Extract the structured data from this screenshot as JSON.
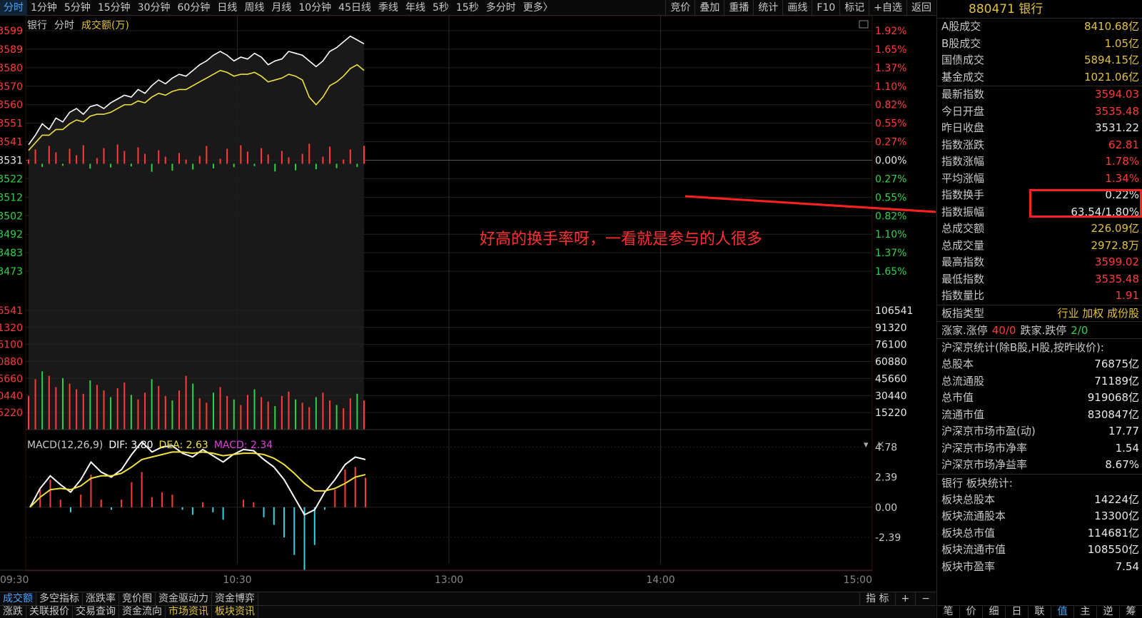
{
  "toolbar": {
    "periods": [
      "分时",
      "1分钟",
      "5分钟",
      "15分钟",
      "30分钟",
      "60分钟",
      "日线",
      "周线",
      "月线",
      "10分钟",
      "45日线",
      "季线",
      "年线",
      "5秒",
      "15秒",
      "多分时",
      "更多〉"
    ],
    "active_period": "分时",
    "tools": [
      "竞价",
      "叠加",
      "重播",
      "统计",
      "画线",
      "F10",
      "标记",
      "+自选",
      "返回"
    ]
  },
  "chart_header": {
    "name": "银行",
    "mode": "分时",
    "amount": "成交额(万)"
  },
  "macd_header": {
    "label": "MACD(12,26,9)",
    "dif": "DIF: 3.80",
    "dea": "DEA: 2.63",
    "macd": "MACD: 2.34"
  },
  "macd_controls": {
    "collapse": "▾",
    "close": "×"
  },
  "annotation": "好高的换手率呀，一看就是参与的人很多",
  "indicator_tabs": [
    "成交额",
    "多空指标",
    "涨跌率",
    "竞价图",
    "资金驱动力",
    "资金博弈"
  ],
  "indicator_controls": [
    "指 标",
    "+",
    "−"
  ],
  "info_tabs": [
    "涨跌",
    "关联报价",
    "交易查询",
    "资金流向",
    "市场资讯",
    "板块资讯"
  ],
  "info_tabs_highlight": [
    "市场资讯",
    "板块资讯"
  ],
  "panel": {
    "title": "880471 银行",
    "group1": [
      {
        "k": "A股成交",
        "v": "8410.68亿",
        "c": "yel"
      },
      {
        "k": "B股成交",
        "v": "1.05亿",
        "c": "yel"
      },
      {
        "k": "国债成交",
        "v": "5894.15亿",
        "c": "yel"
      },
      {
        "k": "基金成交",
        "v": "1021.06亿",
        "c": "yel"
      }
    ],
    "group2": [
      {
        "k": "最新指数",
        "v": "3594.03",
        "c": "red"
      },
      {
        "k": "今日开盘",
        "v": "3535.48",
        "c": "red"
      },
      {
        "k": "昨日收盘",
        "v": "3531.22",
        "c": "wht"
      },
      {
        "k": "指数涨跌",
        "v": "62.81",
        "c": "red"
      },
      {
        "k": "指数涨幅",
        "v": "1.78%",
        "c": "red"
      },
      {
        "k": "平均涨幅",
        "v": "1.34%",
        "c": "red"
      },
      {
        "k": "指数换手",
        "v": "0.22%",
        "c": "wht"
      },
      {
        "k": "指数振幅",
        "v": "63.54/1.80%",
        "c": "wht"
      },
      {
        "k": "总成交额",
        "v": "226.09亿",
        "c": "yel"
      },
      {
        "k": "总成交量",
        "v": "2972.8万",
        "c": "yel"
      },
      {
        "k": "最高指数",
        "v": "3599.02",
        "c": "red"
      },
      {
        "k": "最低指数",
        "v": "3535.48",
        "c": "red"
      },
      {
        "k": "指数量比",
        "v": "1.91",
        "c": "red"
      }
    ],
    "type_row": {
      "k": "板指类型",
      "v": "行业 加权 成份股"
    },
    "rise_row": {
      "k1": "涨家.涨停",
      "v1": "40/0",
      "k2": "跌家.跌停",
      "v2": "2/0"
    },
    "market_title": "沪深京统计(除B股,H股,按昨收价):",
    "group3": [
      {
        "k": "总股本",
        "v": "76875亿",
        "c": "wht"
      },
      {
        "k": "总流通股",
        "v": "71189亿",
        "c": "wht"
      },
      {
        "k": "总市值",
        "v": "919068亿",
        "c": "wht"
      },
      {
        "k": "流通市值",
        "v": "830847亿",
        "c": "wht"
      },
      {
        "k": "沪深京市场市盈(动)",
        "v": "17.77",
        "c": "wht"
      },
      {
        "k": "沪深京市场市净率",
        "v": "1.54",
        "c": "wht"
      },
      {
        "k": "沪深京市场净益率",
        "v": "8.67%",
        "c": "wht"
      }
    ],
    "sector_title": "银行 板块统计:",
    "group4": [
      {
        "k": "板块总股本",
        "v": "14224亿",
        "c": "wht"
      },
      {
        "k": "板块流通股本",
        "v": "13300亿",
        "c": "wht"
      },
      {
        "k": "板块总市值",
        "v": "114681亿",
        "c": "wht"
      },
      {
        "k": "板块流通市值",
        "v": "108550亿",
        "c": "wht"
      },
      {
        "k": "板块市盈率",
        "v": "7.54",
        "c": "wht"
      }
    ],
    "bottom_tabs": [
      "笔",
      "价",
      "细",
      "日",
      "联",
      "值",
      "主",
      "逆",
      "筹"
    ],
    "active_bottom_tab": "值"
  },
  "chart_data": [
    {
      "type": "line",
      "title": "分时",
      "time_ticks": [
        "09:30",
        "10:30",
        "13:00",
        "14:00",
        "15:00"
      ],
      "y_left_ticks": [
        "3599",
        "3589",
        "3580",
        "3570",
        "3560",
        "3551",
        "3541",
        "3531",
        "3522",
        "3512",
        "3502",
        "3492",
        "3483",
        "3473"
      ],
      "y_right_ticks": [
        "1.92%",
        "1.65%",
        "1.37%",
        "1.10%",
        "0.82%",
        "0.55%",
        "0.27%",
        "0.00%",
        "0.27%",
        "0.55%",
        "0.82%",
        "1.10%",
        "1.37%",
        "1.65%"
      ],
      "ylim": [
        3463,
        3599
      ],
      "prev_close": 3531.22,
      "series": [
        {
          "name": "指数",
          "color": "#ffffff",
          "values": [
            3541,
            3546,
            3552,
            3549,
            3555,
            3553,
            3558,
            3560,
            3557,
            3561,
            3562,
            3560,
            3563,
            3565,
            3567,
            3566,
            3570,
            3568,
            3572,
            3575,
            3573,
            3576,
            3578,
            3577,
            3580,
            3583,
            3585,
            3588,
            3590,
            3588,
            3585,
            3587,
            3586,
            3589,
            3587,
            3583,
            3585,
            3586,
            3590,
            3589,
            3588,
            3585,
            3582,
            3585,
            3590,
            3592,
            3595,
            3598,
            3596,
            3594
          ]
        },
        {
          "name": "均价",
          "color": "#f0e040",
          "values": [
            3538,
            3542,
            3546,
            3546,
            3549,
            3549,
            3552,
            3554,
            3553,
            3556,
            3557,
            3557,
            3558,
            3560,
            3562,
            3562,
            3564,
            3563,
            3566,
            3568,
            3567,
            3569,
            3570,
            3570,
            3572,
            3574,
            3576,
            3578,
            3580,
            3579,
            3577,
            3578,
            3578,
            3579,
            3577,
            3574,
            3575,
            3576,
            3578,
            3577,
            3575,
            3566,
            3562,
            3566,
            3572,
            3574,
            3577,
            3581,
            3583,
            3580
          ]
        }
      ]
    },
    {
      "type": "bar",
      "title": "成交额(万)",
      "y_ticks": [
        "106541",
        "91320",
        "76100",
        "60880",
        "45660",
        "30440",
        "15220"
      ],
      "ylim": [
        0,
        121761
      ],
      "values": [
        30000,
        45000,
        52000,
        48000,
        38000,
        46000,
        41000,
        36000,
        32000,
        44000,
        40000,
        35000,
        29000,
        37000,
        42000,
        31000,
        27000,
        33000,
        45000,
        39000,
        30000,
        26000,
        35000,
        48000,
        41000,
        28000,
        24000,
        33000,
        38000,
        30000,
        27000,
        22000,
        31000,
        36000,
        29000,
        25000,
        21000,
        30000,
        34000,
        27000,
        24000,
        20000,
        29000,
        33000,
        26000,
        22000,
        19000,
        28000,
        32000,
        26000
      ],
      "up_down": [
        "r",
        "r",
        "g",
        "r",
        "r",
        "g",
        "r",
        "r",
        "r",
        "g",
        "r",
        "r",
        "g",
        "r",
        "r",
        "g",
        "r",
        "r",
        "g",
        "r",
        "r",
        "g",
        "r",
        "r",
        "g",
        "r",
        "r",
        "g",
        "r",
        "r",
        "g",
        "r",
        "r",
        "g",
        "r",
        "r",
        "g",
        "r",
        "r",
        "g",
        "r",
        "r",
        "g",
        "r",
        "r",
        "g",
        "r",
        "r",
        "g",
        "r"
      ]
    },
    {
      "type": "line",
      "title": "MACD(12,26,9)",
      "y_ticks": [
        "4.78",
        "2.39",
        "0.00",
        "-2.39"
      ],
      "ylim": [
        -4.5,
        5.5
      ],
      "series": [
        {
          "name": "DIF",
          "color": "#ffffff",
          "values": [
            0.0,
            1.5,
            2.5,
            1.8,
            1.2,
            2.2,
            3.6,
            2.8,
            2.4,
            3.0,
            4.2,
            5.2,
            4.4,
            4.8,
            4.9,
            4.3,
            4.0,
            4.6,
            4.1,
            3.6,
            4.2,
            4.6,
            4.5,
            3.8,
            3.2,
            2.2,
            0.8,
            -0.6,
            -0.2,
            1.2,
            2.2,
            3.4,
            4.0,
            3.8
          ]
        },
        {
          "name": "DEA",
          "color": "#f0e040",
          "values": [
            0.0,
            0.8,
            1.4,
            1.5,
            1.4,
            1.7,
            2.3,
            2.5,
            2.5,
            2.7,
            3.2,
            3.8,
            4.0,
            4.2,
            4.4,
            4.4,
            4.3,
            4.4,
            4.3,
            4.1,
            4.2,
            4.3,
            4.3,
            4.2,
            3.9,
            3.4,
            2.7,
            1.9,
            1.3,
            1.3,
            1.5,
            1.9,
            2.4,
            2.6
          ]
        },
        {
          "name": "MACD",
          "color": "#ff3b3b",
          "values": [
            0.0,
            1.4,
            2.2,
            0.6,
            -0.4,
            1.0,
            2.6,
            0.6,
            -0.2,
            0.6,
            2.0,
            2.8,
            0.8,
            1.2,
            1.0,
            -0.2,
            -0.6,
            0.4,
            -0.4,
            -1.0,
            0.0,
            0.6,
            0.4,
            -0.8,
            -1.4,
            -2.4,
            -3.8,
            -5.0,
            -3.0,
            -0.2,
            1.4,
            3.0,
            3.2,
            2.34
          ]
        }
      ]
    }
  ]
}
